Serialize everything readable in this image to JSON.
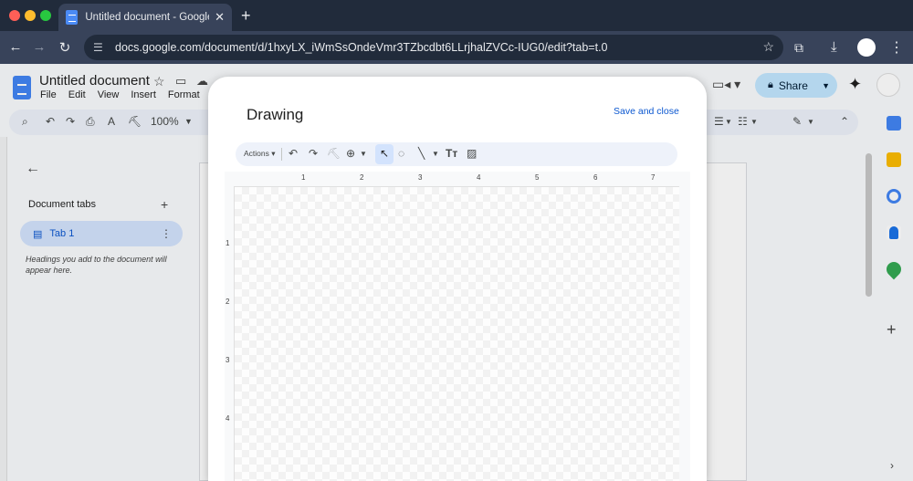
{
  "browser": {
    "tab_title": "Untitled document - Google Docs",
    "url": "docs.google.com/document/d/1hxyLX_iWmSsOndeVmr3TZbcdbt6LLrjhalZVCc-IUG0/edit?tab=t.0"
  },
  "docs": {
    "title": "Untitled document",
    "menu": [
      "File",
      "Edit",
      "View",
      "Insert",
      "Format"
    ],
    "zoom": "100%",
    "share_label": "Share",
    "sidebar": {
      "heading": "Document tabs",
      "tab_label": "Tab 1",
      "hint": "Headings you add to the document will appear here."
    }
  },
  "drawing": {
    "title": "Drawing",
    "save_close": "Save and close",
    "actions_label": "Actions",
    "h_ruler": [
      "1",
      "2",
      "3",
      "4",
      "5",
      "6",
      "7"
    ],
    "v_ruler": [
      "1",
      "2",
      "3",
      "4"
    ]
  },
  "colors": {
    "accent_blue": "#0b57d0",
    "share_bg": "#c2e7ff",
    "selected_tool_bg": "#d3e3fd",
    "chrome_dark": "#212b3b"
  }
}
